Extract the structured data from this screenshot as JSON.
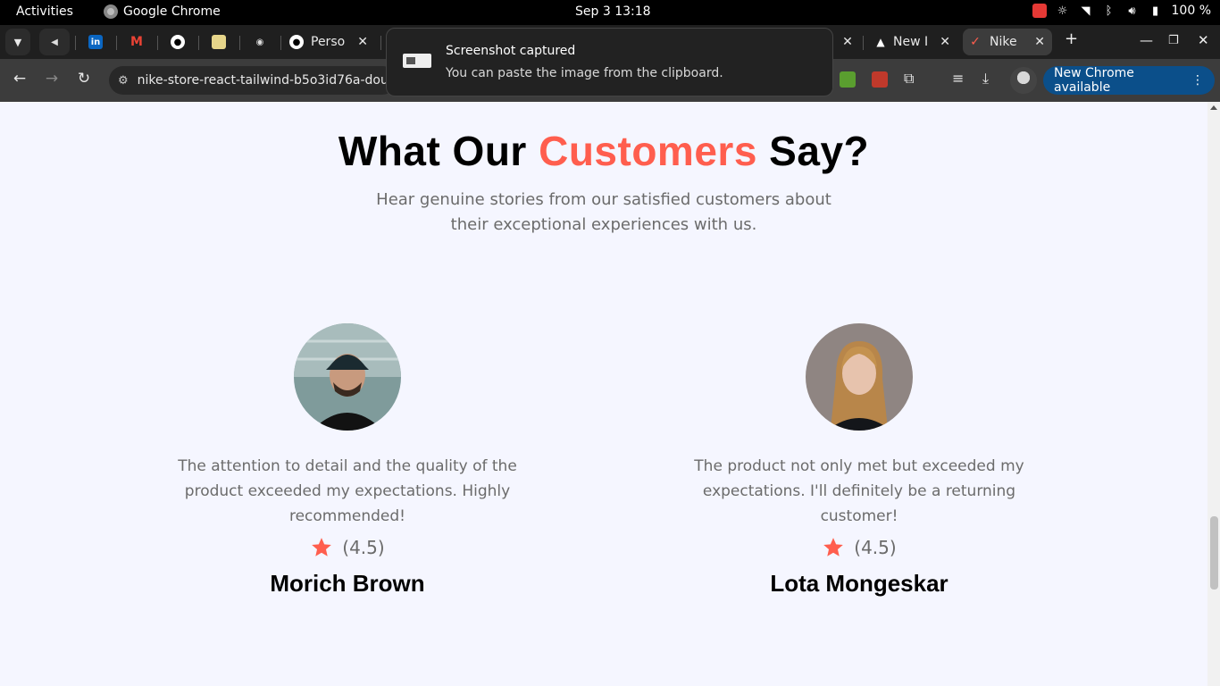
{
  "system_bar": {
    "activities": "Activities",
    "app_name": "Google Chrome",
    "clock": "Sep 3  13:18",
    "battery": "100 %"
  },
  "tabs": [
    {
      "label": "",
      "icon": "volume-icon"
    },
    {
      "label": "",
      "icon": "linkedin-icon"
    },
    {
      "label": "",
      "icon": "gmail-icon"
    },
    {
      "label": "",
      "icon": "github-icon"
    },
    {
      "label": "",
      "icon": "image-icon"
    },
    {
      "label": "",
      "icon": "copilot-icon"
    },
    {
      "label": "Perso",
      "icon": "github-icon"
    },
    {
      "label": "New I",
      "icon": "vercel-icon"
    },
    {
      "label": "Nike",
      "icon": "nike-icon"
    }
  ],
  "toolbar": {
    "url": "nike-store-react-tailwind-b5o3id76a-dougg4",
    "new_chrome_label": "New Chrome available"
  },
  "toast": {
    "title": "Screenshot captured",
    "body": "You can paste the image from the clipboard."
  },
  "section": {
    "title_prefix": "What Our ",
    "title_accent": "Customers",
    "title_suffix": " Say?",
    "subtitle": "Hear genuine stories from our satisfied customers about their exceptional experiences with us."
  },
  "testimonials": [
    {
      "quote": "The attention to detail and the quality of the product exceeded my expectations. Highly recommended!",
      "rating": "(4.5)",
      "name": "Morich Brown"
    },
    {
      "quote": "The product not only met but exceeded my expectations. I'll definitely be a returning customer!",
      "rating": "(4.5)",
      "name": "Lota Mongeskar"
    }
  ],
  "colors": {
    "accent": "#ff5e4e",
    "page_bg": "#f5f6ff",
    "new_chrome_bg": "#0b4f8a"
  }
}
